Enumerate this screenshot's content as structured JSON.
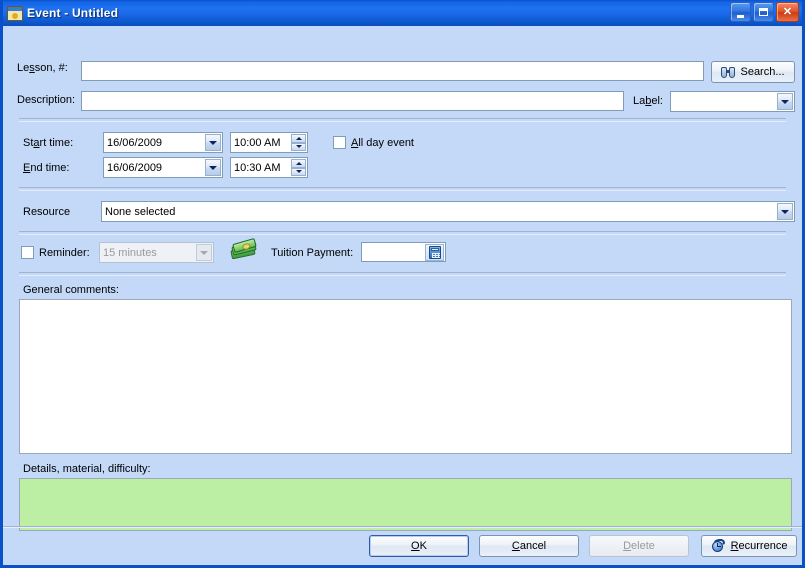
{
  "window": {
    "title": "Event - Untitled",
    "icon": "event-window-icon",
    "buttons": {
      "minimize": "minimize-button",
      "maximize": "restore-button",
      "close": "close-button"
    },
    "colors": {
      "titlebar_blue": "#1464e6",
      "dialog_background": "#c3d9f7",
      "field_white": "#ffffff",
      "details_green": "#bcefa4",
      "close_red": "#e0562c"
    }
  },
  "form": {
    "lesson": {
      "label_pre": "Le",
      "label_accel": "s",
      "label_post": "son, #:",
      "value": "",
      "placeholder": ""
    },
    "search_button": {
      "label": "Search...",
      "icon": "binoculars-icon"
    },
    "description": {
      "label": "Description:",
      "value": "",
      "placeholder": ""
    },
    "label_field": {
      "label_pre": "La",
      "label_accel": "b",
      "label_post": "el:",
      "value": ""
    },
    "start_time": {
      "label_pre": "St",
      "label_accel": "a",
      "label_post": "rt time:",
      "date": "16/06/2009",
      "time": "10:00 AM"
    },
    "end_time": {
      "label_pre": "",
      "label_accel": "E",
      "label_post": "nd time:",
      "date": "16/06/2009",
      "time": "10:30 AM"
    },
    "all_day": {
      "label_pre": "",
      "label_accel": "A",
      "label_post": "ll day event",
      "checked": false
    },
    "resource": {
      "label": "Resource",
      "value": "None selected"
    },
    "reminder": {
      "label": "Reminder:",
      "checked": false,
      "interval": "15 minutes",
      "disabled": true
    },
    "tuition": {
      "icon": "money-icon",
      "label": "Tuition Payment:",
      "value": "",
      "calculator_icon": "calculator-icon"
    },
    "general_comments": {
      "label": "General comments:",
      "value": ""
    },
    "details": {
      "label": "Details, material, difficulty:",
      "value": ""
    }
  },
  "footer": {
    "ok": {
      "label_pre": "O",
      "label_accel": "K",
      "label_post": "",
      "default": true
    },
    "cancel": {
      "label_pre": "",
      "label_accel": "C",
      "label_post": "ancel"
    },
    "delete": {
      "label_pre": "",
      "label_accel": "D",
      "label_post": "elete",
      "disabled": true
    },
    "recurrence": {
      "label_pre": "",
      "label_accel": "R",
      "label_post": "ecurrence",
      "icon": "clock-recurrence-icon"
    }
  }
}
